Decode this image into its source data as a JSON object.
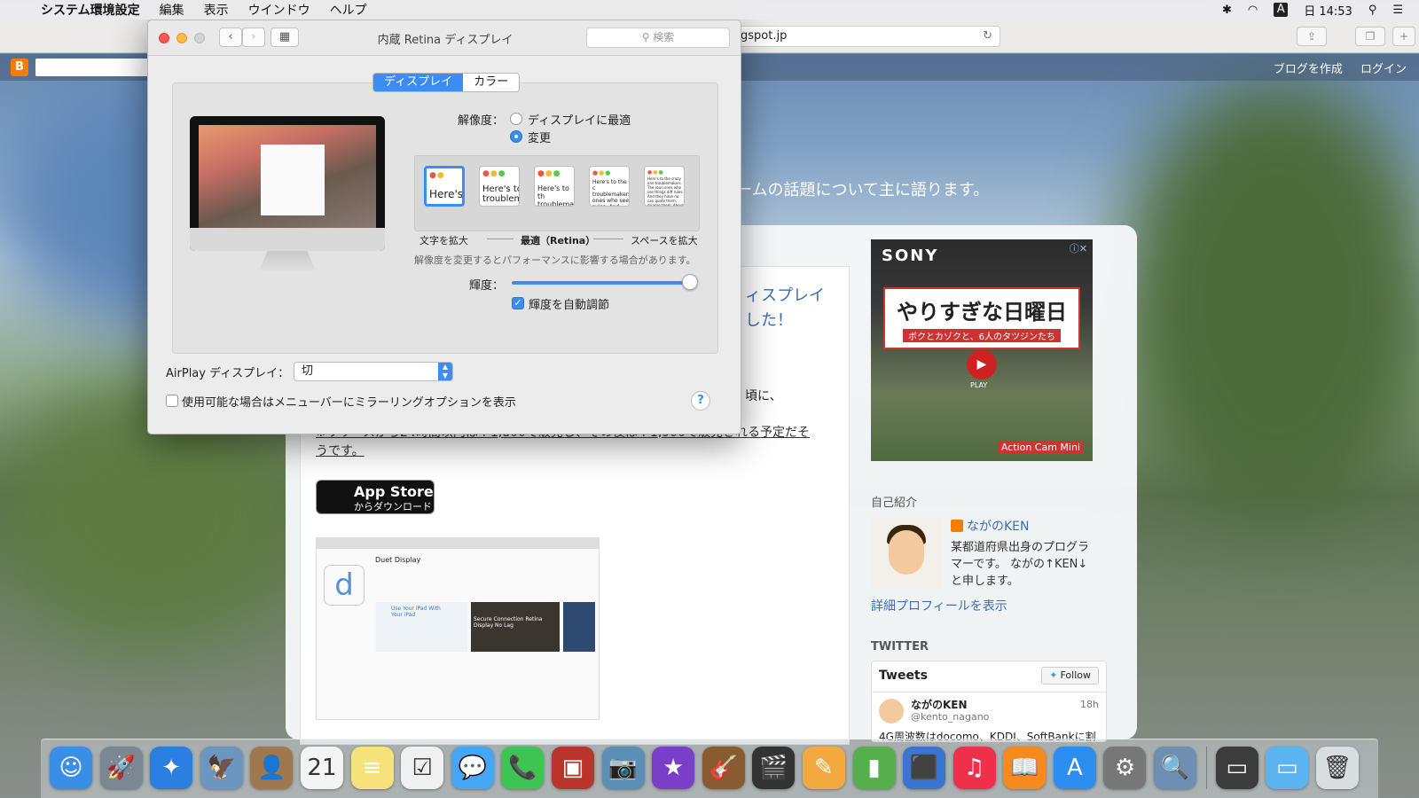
{
  "menubar": {
    "apple_glyph": "",
    "app_name": "システム環境設定",
    "items": [
      "編集",
      "表示",
      "ウインドウ",
      "ヘルプ"
    ],
    "input_badge": "A",
    "clock": "日 14:53"
  },
  "browser": {
    "url": "gspot.jp",
    "blogger_links": [
      "ブログを作成",
      "ログイン"
    ]
  },
  "blog": {
    "tagline": "ームの話題について主に語ります。",
    "post_title_line1": "ィスプレイ",
    "post_title_line2": "した！",
    "post_text": "頃に、",
    "post_link": "※リリースから24時間以内は￥1,800で販売し、その後は￥1,900で販売される予定だそうです。",
    "appstore_title": "App Store",
    "appstore_sub": "からダウンロード",
    "screenshot_app_name": "Duet Display",
    "screenshot_tile1": "Use Your iPad With Your iPad",
    "screenshot_tile2": "Secure Connection Retina Display No Lag",
    "ad": {
      "brand": "SONY",
      "headline": "やりすぎな日曜日",
      "subline": "ボクとカゾクと、6人のタツジンたち",
      "play": "PLAY",
      "product": "Action Cam Mini"
    },
    "profile_heading": "自己紹介",
    "profile_name": "ながのKEN",
    "profile_desc": "某都道府県出身のプログラマーです。 ながの↑KEN↓と申します。",
    "profile_link": "詳細プロフィールを表示",
    "twitter_heading": "TWITTER",
    "tweets_label": "Tweets",
    "follow_label": "Follow",
    "tweet_name": "ながのKEN",
    "tweet_handle": "@kento_nagano",
    "tweet_time": "18h",
    "tweet_text": "4G周波数はdocomo、KDDI、SoftBankに割"
  },
  "prefs": {
    "title": "内蔵 Retina ディスプレイ",
    "search_placeholder": "検索",
    "tabs": [
      "ディスプレイ",
      "カラー"
    ],
    "resolution_label": "解像度：",
    "option_best": "ディスプレイに最適",
    "option_scaled": "変更",
    "scale_thumbs": [
      "Here's",
      "Here's to troublem",
      "Here's to th troublemak ones who",
      "Here's to the c troublemakers ones who see rules. And they",
      "Here's to the crazy one troublemakers. The roun ones who see things diff rules. And they have no can quote them, disagre them. About the only thi Because they change th"
    ],
    "scale_left": "文字を拡大",
    "scale_mid": "最適（Retina）",
    "scale_right": "スペースを拡大",
    "note": "解像度を変更するとパフォーマンスに影響する場合があります。",
    "brightness_label": "輝度：",
    "brightness_level": 1.0,
    "auto_brightness": "輝度を自動調節",
    "airplay_label": "AirPlay ディスプレイ：",
    "airplay_value": "切",
    "mirror_option": "使用可能な場合はメニューバーにミラーリングオプションを表示",
    "help": "?"
  },
  "dock": {
    "icons": [
      {
        "name": "finder-icon",
        "glyph": "☺",
        "color": "#3a8ee6"
      },
      {
        "name": "launchpad-icon",
        "glyph": "🚀",
        "color": "#7c8794"
      },
      {
        "name": "safari-icon",
        "glyph": "✦",
        "color": "#2a7fe0"
      },
      {
        "name": "preview-eagle-icon",
        "glyph": "🦅",
        "color": "#6a96c0"
      },
      {
        "name": "contacts-icon",
        "glyph": "👤",
        "color": "#a0784e"
      },
      {
        "name": "calendar-icon",
        "glyph": "21",
        "color": "#f4f4f4"
      },
      {
        "name": "notes-icon",
        "glyph": "≡",
        "color": "#f5e27a"
      },
      {
        "name": "reminders-icon",
        "glyph": "☑",
        "color": "#f0f0f0"
      },
      {
        "name": "messages-icon",
        "glyph": "💬",
        "color": "#46a6f6"
      },
      {
        "name": "facetime-icon",
        "glyph": "📞",
        "color": "#3ec453"
      },
      {
        "name": "photo-booth-icon",
        "glyph": "▣",
        "color": "#b8342c"
      },
      {
        "name": "iphoto-icon",
        "glyph": "📷",
        "color": "#5b8fb5"
      },
      {
        "name": "imovie-icon",
        "glyph": "★",
        "color": "#7a3fc8"
      },
      {
        "name": "garageband-icon",
        "glyph": "🎸",
        "color": "#8a5a30"
      },
      {
        "name": "final-cut-icon",
        "glyph": "🎬",
        "color": "#333"
      },
      {
        "name": "pages-icon",
        "glyph": "✎",
        "color": "#f1a940"
      },
      {
        "name": "numbers-icon",
        "glyph": "▮",
        "color": "#55b04c"
      },
      {
        "name": "keynote-icon",
        "glyph": "⬛",
        "color": "#3a75d0"
      },
      {
        "name": "itunes-icon",
        "glyph": "♫",
        "color": "#f0304a"
      },
      {
        "name": "ibooks-icon",
        "glyph": "📖",
        "color": "#f58a1f"
      },
      {
        "name": "app-store-icon",
        "glyph": "A",
        "color": "#2d8ef2"
      },
      {
        "name": "system-preferences-icon",
        "glyph": "⚙",
        "color": "#777"
      },
      {
        "name": "preview-icon",
        "glyph": "🔍",
        "color": "#6f8fb2"
      },
      {
        "name": "folder-icon",
        "glyph": "▭",
        "color": "#3c3c3c"
      },
      {
        "name": "downloads-folder-icon",
        "glyph": "▭",
        "color": "#5bb4ef"
      },
      {
        "name": "trash-icon",
        "glyph": "🗑",
        "color": "#d8dde2"
      }
    ]
  }
}
